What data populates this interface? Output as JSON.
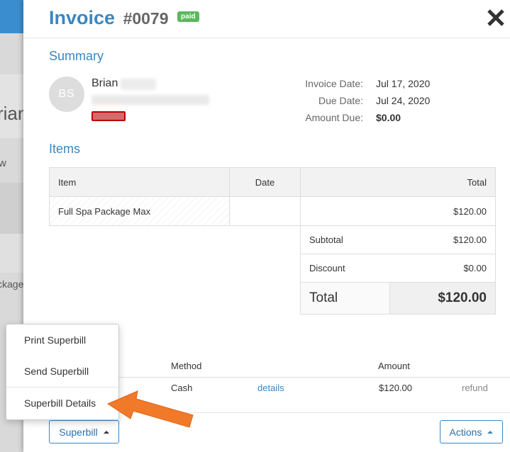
{
  "background": {
    "fragments": [
      "rian",
      "w",
      "ckage"
    ]
  },
  "header": {
    "title": "Invoice",
    "number": "#0079",
    "status_badge": "paid"
  },
  "summary": {
    "section_title": "Summary",
    "avatar_initials": "BS",
    "customer_name": "Brian",
    "meta": [
      {
        "label": "Invoice Date:",
        "value": "Jul 17, 2020"
      },
      {
        "label": "Due Date:",
        "value": "Jul 24, 2020"
      },
      {
        "label": "Amount Due:",
        "value": "$0.00"
      }
    ]
  },
  "items": {
    "section_title": "Items",
    "columns": {
      "item": "Item",
      "date": "Date",
      "total": "Total"
    },
    "rows": [
      {
        "item": "Full Spa Package Max",
        "date": "",
        "total": "$120.00"
      }
    ],
    "subtotal_label": "Subtotal",
    "subtotal_value": "$120.00",
    "discount_label": "Discount",
    "discount_value": "$0.00",
    "total_label": "Total",
    "total_value": "$120.00"
  },
  "payments": {
    "columns": {
      "method": "Method",
      "amount": "Amount"
    },
    "rows": [
      {
        "method": "Cash",
        "details_link": "details",
        "amount": "$120.00",
        "refund_link": "refund"
      }
    ]
  },
  "footer": {
    "superbill_button": "Superbill",
    "actions_button": "Actions"
  },
  "superbill_menu": {
    "items": [
      "Print Superbill",
      "Send Superbill",
      "Superbill Details"
    ]
  },
  "colors": {
    "accent": "#3a87c0",
    "paid": "#5cb85c",
    "arrow": "#f07a2a"
  }
}
